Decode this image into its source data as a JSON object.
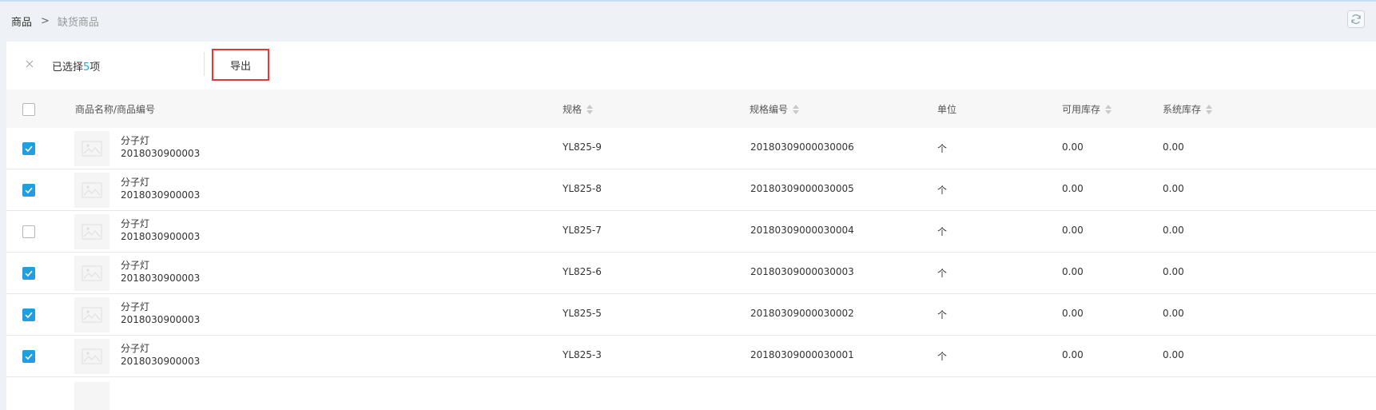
{
  "breadcrumb": {
    "root": "商品",
    "separator": ">",
    "current": "缺货商品"
  },
  "toolbar": {
    "selected_prefix": "已选择",
    "selected_count": "5",
    "selected_suffix": "项",
    "export_label": "导出"
  },
  "table": {
    "columns": {
      "name": "商品名称/商品编号",
      "spec": "规格",
      "spec_code": "规格编号",
      "unit": "单位",
      "available_stock": "可用库存",
      "system_stock": "系统库存"
    },
    "rows": [
      {
        "checked": true,
        "name": "分子灯",
        "code": "2018030900003",
        "spec": "YL825-9",
        "spec_code": "20180309000030006",
        "unit": "个",
        "available": "0.00",
        "system": "0.00"
      },
      {
        "checked": true,
        "name": "分子灯",
        "code": "2018030900003",
        "spec": "YL825-8",
        "spec_code": "20180309000030005",
        "unit": "个",
        "available": "0.00",
        "system": "0.00"
      },
      {
        "checked": false,
        "name": "分子灯",
        "code": "2018030900003",
        "spec": "YL825-7",
        "spec_code": "20180309000030004",
        "unit": "个",
        "available": "0.00",
        "system": "0.00"
      },
      {
        "checked": true,
        "name": "分子灯",
        "code": "2018030900003",
        "spec": "YL825-6",
        "spec_code": "20180309000030003",
        "unit": "个",
        "available": "0.00",
        "system": "0.00"
      },
      {
        "checked": true,
        "name": "分子灯",
        "code": "2018030900003",
        "spec": "YL825-5",
        "spec_code": "20180309000030002",
        "unit": "个",
        "available": "0.00",
        "system": "0.00"
      },
      {
        "checked": true,
        "name": "分子灯",
        "code": "2018030900003",
        "spec": "YL825-3",
        "spec_code": "20180309000030001",
        "unit": "个",
        "available": "0.00",
        "system": "0.00"
      }
    ]
  },
  "icons": {
    "refresh": "refresh-icon",
    "close": "close-icon",
    "sort": "sort-icon",
    "image_placeholder": "image-placeholder-icon",
    "check": "check-icon"
  },
  "colors": {
    "accent": "#1f9ee0",
    "count": "#29a3dc",
    "export_highlight": "#e03a3a",
    "page_bg": "#eef1f5"
  }
}
